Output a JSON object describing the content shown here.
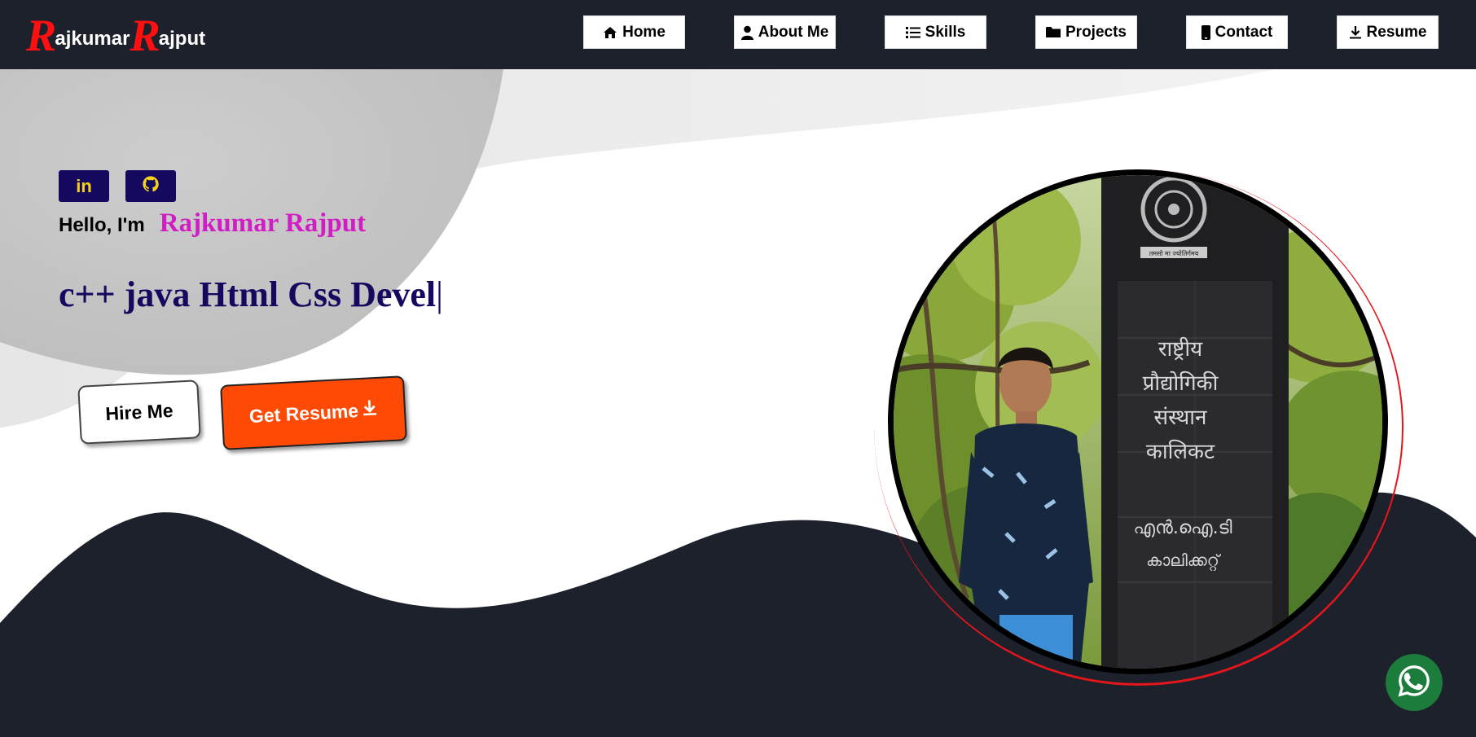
{
  "brand": {
    "first_initial": "R",
    "first_rest": "ajkumar",
    "last_initial": "R",
    "last_rest": "ajput"
  },
  "nav": {
    "items": [
      {
        "label": "Home",
        "icon": "home-icon"
      },
      {
        "label": "About Me",
        "icon": "user-icon"
      },
      {
        "label": "Skills",
        "icon": "list-icon"
      },
      {
        "label": "Projects",
        "icon": "folder-icon"
      },
      {
        "label": "Contact",
        "icon": "phone-icon"
      },
      {
        "label": "Resume",
        "icon": "download-icon"
      }
    ]
  },
  "social": {
    "linkedin_label": "in",
    "linkedin_icon": "linkedin-icon",
    "github_icon": "github-icon"
  },
  "hero": {
    "greeting": "Hello, I'm",
    "name": "Rajkumar Rajput",
    "typed_text": "c++ java Html Css Devel",
    "cursor": "|",
    "hire_label": "Hire Me",
    "resume_label": "Get Resume"
  },
  "photo": {
    "sign_lines": [
      "राष्ट्रीय",
      "प्रौद्योगिकी",
      "संस्थान",
      "कालिकट",
      "എൻ.ഐ.ടി",
      "കാലിക്കറ്റ്"
    ],
    "sign_caption": "तमसो मा ज्योतिर्गमय"
  },
  "colors": {
    "header_bg": "#1d212c",
    "brand_red": "#ff1010",
    "social_bg": "#14095e",
    "social_fg": "#f6d21a",
    "name_color": "#d11ec4",
    "typed_color": "#14095e",
    "resume_button": "#ff4a05",
    "whatsapp": "#1c7c3c"
  },
  "whatsapp": {
    "icon": "whatsapp-icon"
  }
}
